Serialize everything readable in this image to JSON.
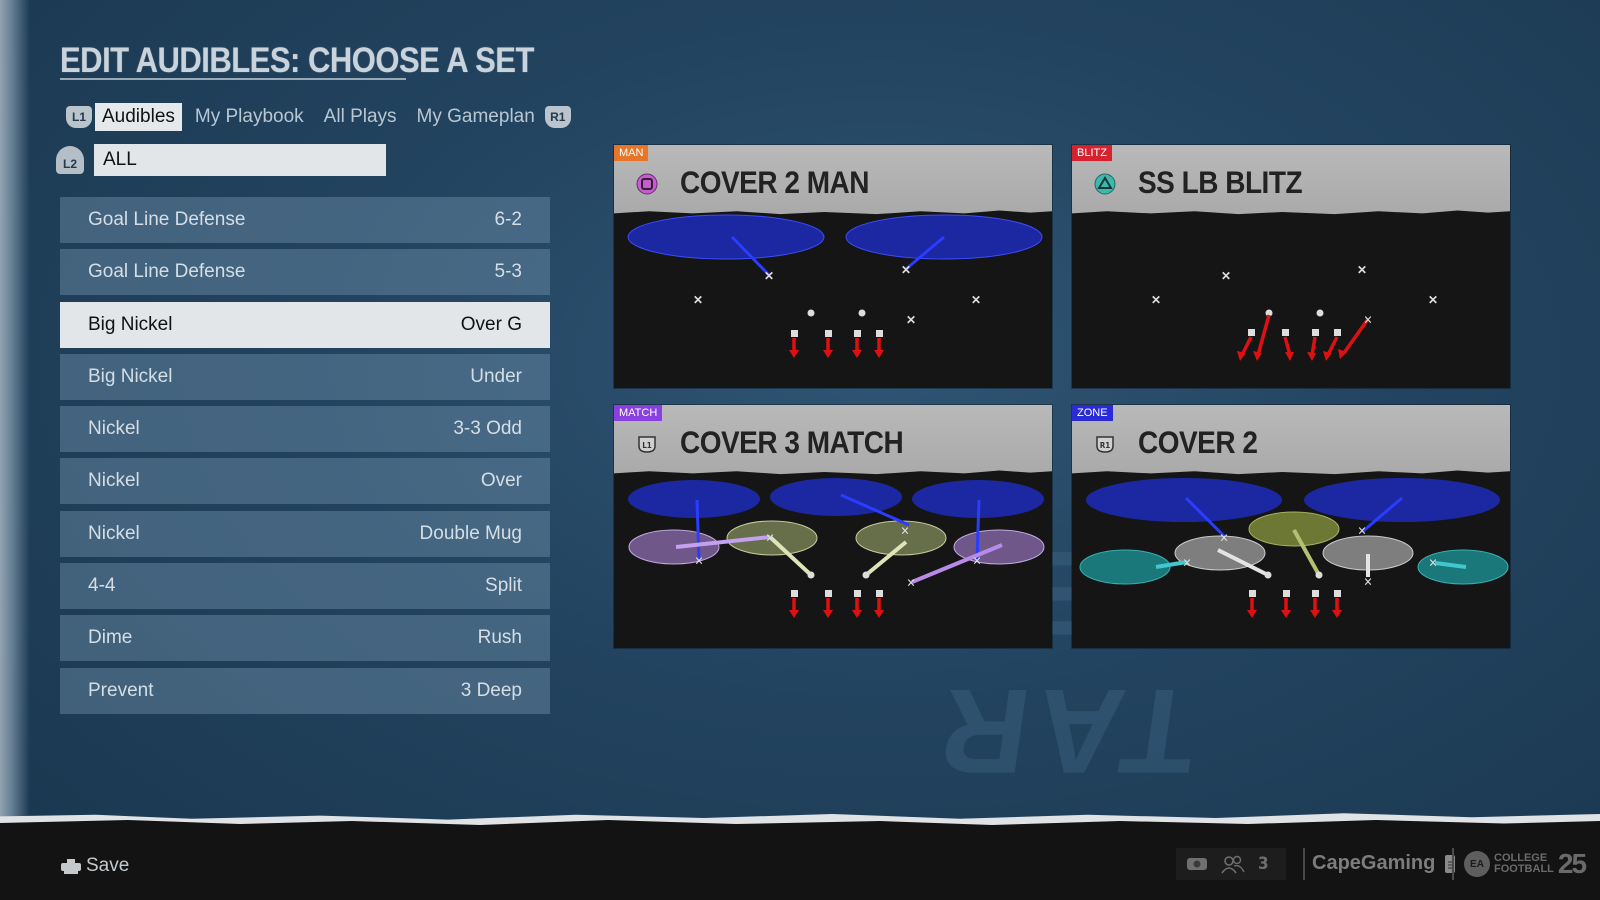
{
  "header": {
    "title": "EDIT AUDIBLES: CHOOSE A SET"
  },
  "tabs": {
    "left_button": "L1",
    "right_button": "R1",
    "items": [
      {
        "label": "Audibles",
        "active": true
      },
      {
        "label": "My Playbook",
        "active": false
      },
      {
        "label": "All Plays",
        "active": false
      },
      {
        "label": "My Gameplan",
        "active": false
      }
    ]
  },
  "filter": {
    "button": "L2",
    "value": "ALL"
  },
  "formations": [
    {
      "name": "Goal Line Defense",
      "set": "6-2",
      "selected": false
    },
    {
      "name": "Goal Line Defense",
      "set": "5-3",
      "selected": false
    },
    {
      "name": "Big Nickel",
      "set": "Over G",
      "selected": true
    },
    {
      "name": "Big Nickel",
      "set": "Under",
      "selected": false
    },
    {
      "name": "Nickel",
      "set": "3-3 Odd",
      "selected": false
    },
    {
      "name": "Nickel",
      "set": "Over",
      "selected": false
    },
    {
      "name": "Nickel",
      "set": "Double Mug",
      "selected": false
    },
    {
      "name": "4-4",
      "set": "Split",
      "selected": false
    },
    {
      "name": "Dime",
      "set": "Rush",
      "selected": false
    },
    {
      "name": "Prevent",
      "set": "3 Deep",
      "selected": false
    }
  ],
  "audibles": [
    {
      "tag": "MAN",
      "tag_color": "#e8762a",
      "title": "COVER 2 MAN",
      "button": "square",
      "button_color": "#c060c8"
    },
    {
      "tag": "BLITZ",
      "tag_color": "#d4232e",
      "title": "SS LB BLITZ",
      "button": "triangle",
      "button_color": "#3fb7ad"
    },
    {
      "tag": "MATCH",
      "tag_color": "#8a3fe0",
      "title": "COVER 3 MATCH",
      "button": "L1",
      "button_color": "#bdbdbd"
    },
    {
      "tag": "ZONE",
      "tag_color": "#2a2ad8",
      "title": "COVER 2",
      "button": "R1",
      "button_color": "#bdbdbd"
    }
  ],
  "footer": {
    "save_label": "Save",
    "party_count": "3",
    "username": "CapeGaming",
    "logo_line1": "COLLEGE",
    "logo_line2": "FOOTBALL",
    "logo_number": "25",
    "logo_badge": "EA"
  }
}
